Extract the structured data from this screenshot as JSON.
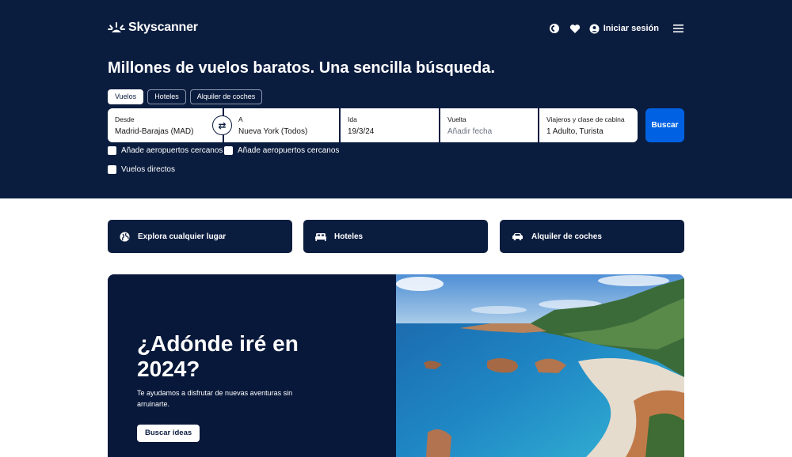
{
  "brand": {
    "name": "Skyscanner"
  },
  "header": {
    "login_label": "Iniciar sesión",
    "icons": [
      "globe-icon",
      "heart-icon",
      "user-icon",
      "menu-icon"
    ]
  },
  "headline": "Millones de vuelos baratos. Una sencilla búsqueda.",
  "tabs": [
    {
      "label": "Vuelos",
      "active": true
    },
    {
      "label": "Hoteles",
      "active": false
    },
    {
      "label": "Alquiler de coches",
      "active": false
    }
  ],
  "search": {
    "from": {
      "label": "Desde",
      "value": "Madrid-Barajas (MAD)"
    },
    "to": {
      "label": "A",
      "value": "Nueva York (Todos)"
    },
    "depart": {
      "label": "Ida",
      "value": "19/3/24"
    },
    "return": {
      "label": "Vuelta",
      "placeholder": "Añadir fecha"
    },
    "travellers": {
      "label": "Viajeros y clase de cabina",
      "value": "1 Adulto, Turista"
    },
    "button_label": "Buscar",
    "nearby_from_label": "Añade aeropuertos cercanos",
    "nearby_to_label": "Añade aeropuertos cercanos",
    "direct_label": "Vuelos directos"
  },
  "quick_links": [
    {
      "label": "Explora cualquier lugar",
      "icon": "globe-icon"
    },
    {
      "label": "Hoteles",
      "icon": "bed-icon"
    },
    {
      "label": "Alquiler de coches",
      "icon": "car-icon"
    }
  ],
  "promo": {
    "title": "¿Adónde iré en 2024?",
    "subtitle": "Te ayudamos a disfrutar de nuevas aventuras sin arruinarte.",
    "button_label": "Buscar ideas"
  },
  "colors": {
    "navy": "#0b1d3f",
    "accent_blue": "#0062e3",
    "white": "#ffffff"
  }
}
